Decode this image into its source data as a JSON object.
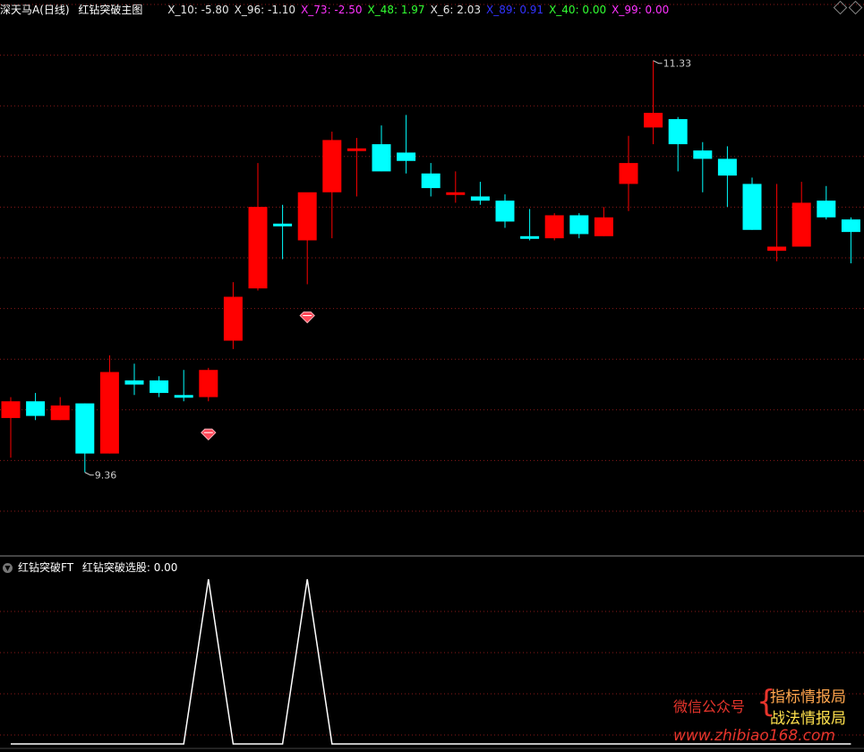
{
  "header": {
    "stock": "深天马A",
    "period": "(日线)",
    "indicator": "红钻突破主图",
    "params": [
      {
        "label": "X_10: -5.80",
        "color": "#e6e6e6"
      },
      {
        "label": "X_96: -1.10",
        "color": "#e6e6e6"
      },
      {
        "label": "X_73: -2.50",
        "color": "#ff33ff"
      },
      {
        "label": "X_48: 1.97",
        "color": "#33ff33"
      },
      {
        "label": "X_6: 2.03",
        "color": "#e6e6e6"
      },
      {
        "label": "X_89: 0.91",
        "color": "#3333ff"
      },
      {
        "label": "X_40: 0.00",
        "color": "#33ff33"
      },
      {
        "label": "X_99: 0.00",
        "color": "#ff33ff"
      }
    ]
  },
  "sub_header": {
    "indicator": "红钻突破FT",
    "label": "红钻突破选股: 0.00"
  },
  "watermark": {
    "account": "微信公众号",
    "name1": "指标情报局",
    "name2": "战法情报局",
    "url": "www.zhibiao168.com"
  },
  "colors": {
    "up": "#ff0000",
    "down": "#00ffff",
    "grid": "#8b1a1a",
    "signal": "#ffffff"
  },
  "chart_data": [
    {
      "type": "candlestick",
      "title": "红钻突破主图",
      "ylim": [
        9.05,
        11.5
      ],
      "annotations": [
        {
          "text": "11.33",
          "index": 26,
          "value": 11.33
        },
        {
          "text": "9.36",
          "index": 3,
          "value": 9.36
        }
      ],
      "diamond_marks": [
        8,
        12
      ],
      "candles": [
        {
          "o": 9.62,
          "h": 9.72,
          "l": 9.43,
          "c": 9.7
        },
        {
          "o": 9.7,
          "h": 9.74,
          "l": 9.61,
          "c": 9.63
        },
        {
          "o": 9.61,
          "h": 9.72,
          "l": 9.61,
          "c": 9.68
        },
        {
          "o": 9.69,
          "h": 9.69,
          "l": 9.36,
          "c": 9.45
        },
        {
          "o": 9.45,
          "h": 9.92,
          "l": 9.45,
          "c": 9.84
        },
        {
          "o": 9.8,
          "h": 9.88,
          "l": 9.73,
          "c": 9.78
        },
        {
          "o": 9.8,
          "h": 9.82,
          "l": 9.72,
          "c": 9.74
        },
        {
          "o": 9.73,
          "h": 9.85,
          "l": 9.7,
          "c": 9.72
        },
        {
          "o": 9.72,
          "h": 9.86,
          "l": 9.7,
          "c": 9.85
        },
        {
          "o": 9.99,
          "h": 10.27,
          "l": 9.95,
          "c": 10.2
        },
        {
          "o": 10.24,
          "h": 10.84,
          "l": 10.23,
          "c": 10.63
        },
        {
          "o": 10.55,
          "h": 10.64,
          "l": 10.38,
          "c": 10.54
        },
        {
          "o": 10.47,
          "h": 10.66,
          "l": 10.26,
          "c": 10.7
        },
        {
          "o": 10.7,
          "h": 10.99,
          "l": 10.48,
          "c": 10.95
        },
        {
          "o": 10.91,
          "h": 10.96,
          "l": 10.68,
          "c": 10.91
        },
        {
          "o": 10.93,
          "h": 11.02,
          "l": 10.8,
          "c": 10.8
        },
        {
          "o": 10.89,
          "h": 11.07,
          "l": 10.79,
          "c": 10.85
        },
        {
          "o": 10.79,
          "h": 10.84,
          "l": 10.68,
          "c": 10.72
        },
        {
          "o": 10.7,
          "h": 10.8,
          "l": 10.65,
          "c": 10.7
        },
        {
          "o": 10.68,
          "h": 10.75,
          "l": 10.64,
          "c": 10.66
        },
        {
          "o": 10.66,
          "h": 10.69,
          "l": 10.53,
          "c": 10.56
        },
        {
          "o": 10.49,
          "h": 10.62,
          "l": 10.47,
          "c": 10.48
        },
        {
          "o": 10.48,
          "h": 10.6,
          "l": 10.47,
          "c": 10.59
        },
        {
          "o": 10.59,
          "h": 10.6,
          "l": 10.48,
          "c": 10.5
        },
        {
          "o": 10.49,
          "h": 10.63,
          "l": 10.49,
          "c": 10.58
        },
        {
          "o": 10.74,
          "h": 10.97,
          "l": 10.61,
          "c": 10.84
        },
        {
          "o": 11.01,
          "h": 11.33,
          "l": 10.93,
          "c": 11.08
        },
        {
          "o": 11.05,
          "h": 11.06,
          "l": 10.8,
          "c": 10.93
        },
        {
          "o": 10.9,
          "h": 10.94,
          "l": 10.7,
          "c": 10.86
        },
        {
          "o": 10.86,
          "h": 10.92,
          "l": 10.63,
          "c": 10.78
        },
        {
          "o": 10.74,
          "h": 10.77,
          "l": 10.52,
          "c": 10.52
        },
        {
          "o": 10.42,
          "h": 10.74,
          "l": 10.37,
          "c": 10.44
        },
        {
          "o": 10.44,
          "h": 10.75,
          "l": 10.44,
          "c": 10.65
        },
        {
          "o": 10.66,
          "h": 10.73,
          "l": 10.57,
          "c": 10.58
        },
        {
          "o": 10.57,
          "h": 10.58,
          "l": 10.36,
          "c": 10.51
        }
      ]
    },
    {
      "type": "line",
      "title": "红钻突破FT",
      "series": [
        {
          "name": "红钻突破选股",
          "values": [
            0,
            0,
            0,
            0,
            0,
            0,
            0,
            0,
            1,
            0,
            0,
            0,
            1,
            0,
            0,
            0,
            0,
            0,
            0,
            0,
            0,
            0,
            0,
            0,
            0,
            0,
            0,
            0,
            0,
            0,
            0,
            0,
            0,
            0,
            0
          ]
        }
      ]
    }
  ]
}
